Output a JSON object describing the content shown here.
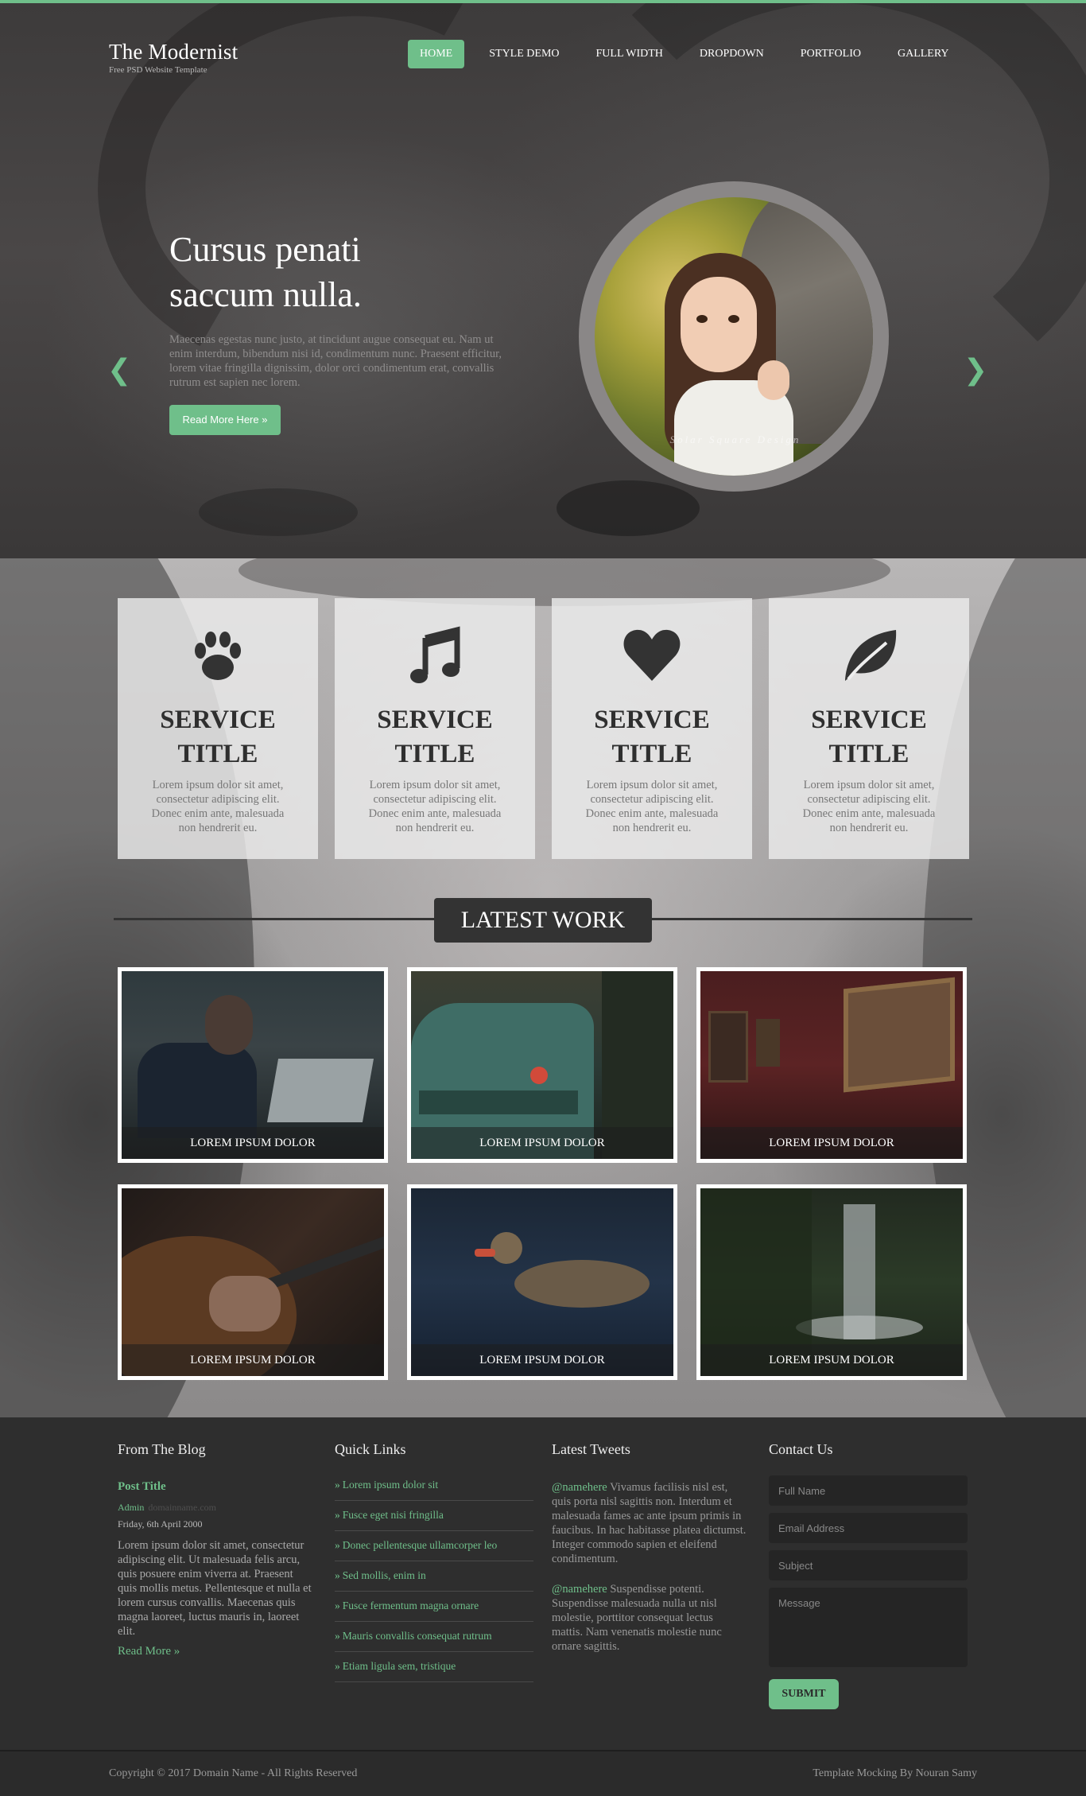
{
  "header": {
    "brand": "The Modernist",
    "tagline": "Free PSD Website Template",
    "nav": [
      {
        "label": "HOME"
      },
      {
        "label": "STYLE DEMO"
      },
      {
        "label": "FULL WIDTH"
      },
      {
        "label": "DROPDOWN"
      },
      {
        "label": "PORTFOLIO"
      },
      {
        "label": "GALLERY"
      }
    ],
    "active_nav": "HOME"
  },
  "slider": {
    "title_line1": "Cursus penati",
    "title_line2": "saccum nulla.",
    "text": "Maecenas egestas nunc justo, at tincidunt augue consequat eu. Nam ut enim interdum, bibendum nisi id, condimentum nunc. Praesent efficitur, lorem vitae fringilla dignissim, dolor orci condimentum erat, convallis rutrum est sapien nec lorem.",
    "button": "Read More Here »",
    "prev_icon": "chevron-left-icon",
    "next_icon": "chevron-right-icon",
    "prev_glyph": "❮",
    "next_glyph": "❯",
    "watermark": "Solar Square Design"
  },
  "services": [
    {
      "icon": "paw-icon",
      "title_line1": "SERVICE",
      "title_line2": "TITLE",
      "text": "Lorem ipsum dolor sit amet, consectetur adipiscing elit. Donec enim ante, malesuada non hendrerit eu."
    },
    {
      "icon": "music-note-icon",
      "title_line1": "SERVICE",
      "title_line2": "TITLE",
      "text": "Lorem ipsum dolor sit amet, consectetur adipiscing elit. Donec enim ante, malesuada non hendrerit eu."
    },
    {
      "icon": "heart-icon",
      "title_line1": "SERVICE",
      "title_line2": "TITLE",
      "text": "Lorem ipsum dolor sit amet, consectetur adipiscing elit. Donec enim ante, malesuada non hendrerit eu."
    },
    {
      "icon": "leaf-icon",
      "title_line1": "SERVICE",
      "title_line2": "TITLE",
      "text": "Lorem ipsum dolor sit amet, consectetur adipiscing elit. Donec enim ante, malesuada non hendrerit eu."
    }
  ],
  "latest_work": {
    "heading": "LATEST WORK",
    "items": [
      {
        "caption": "LOREM IPSUM DOLOR"
      },
      {
        "caption": "LOREM IPSUM DOLOR"
      },
      {
        "caption": "LOREM IPSUM DOLOR"
      },
      {
        "caption": "LOREM IPSUM DOLOR"
      },
      {
        "caption": "LOREM IPSUM DOLOR"
      },
      {
        "caption": "LOREM IPSUM DOLOR"
      }
    ]
  },
  "footer": {
    "blog": {
      "heading": "From The Blog",
      "post_title": "Post Title",
      "author": "Admin",
      "domain": "domainname.com",
      "date": "Friday, 6th April 2000",
      "body": "Lorem ipsum dolor sit amet, consectetur adipiscing elit. Ut malesuada felis arcu, quis posuere enim viverra at. Praesent quis mollis metus. Pellentesque et nulla et lorem cursus convallis. Maecenas quis magna laoreet, luctus mauris in, laoreet elit.",
      "read_more": "Read More »"
    },
    "quick_links": {
      "heading": "Quick Links",
      "items": [
        "Lorem ipsum dolor sit",
        "Fusce eget nisi fringilla",
        "Donec pellentesque ullamcorper leo",
        "Sed mollis, enim in",
        "Fusce fermentum magna ornare",
        "Mauris convallis consequat rutrum",
        "Etiam ligula sem, tristique"
      ]
    },
    "tweets": {
      "heading": "Latest Tweets",
      "items": [
        {
          "handle": "@namehere",
          "text": " Vivamus facilisis nisl est, quis porta nisl sagittis non. Interdum et malesuada fames ac ante ipsum primis in faucibus. In hac habitasse platea dictumst. Integer commodo sapien et eleifend condimentum."
        },
        {
          "handle": "@namehere",
          "text": " Suspendisse potenti. Suspendisse malesuada nulla ut nisl molestie, porttitor consequat lectus mattis. Nam venenatis molestie nunc ornare sagittis."
        }
      ]
    },
    "contact": {
      "heading": "Contact Us",
      "full_name_placeholder": "Full Name",
      "email_placeholder": "Email Address",
      "subject_placeholder": "Subject",
      "message_placeholder": "Message",
      "submit": "SUBMIT"
    }
  },
  "bottom": {
    "copyright": "Copyright © 2017 Domain Name - All Rights Reserved",
    "credit": "Template Mocking By Nouran Samy"
  },
  "colors": {
    "accent": "#6fbf8a",
    "dark": "#2e2e2e"
  }
}
